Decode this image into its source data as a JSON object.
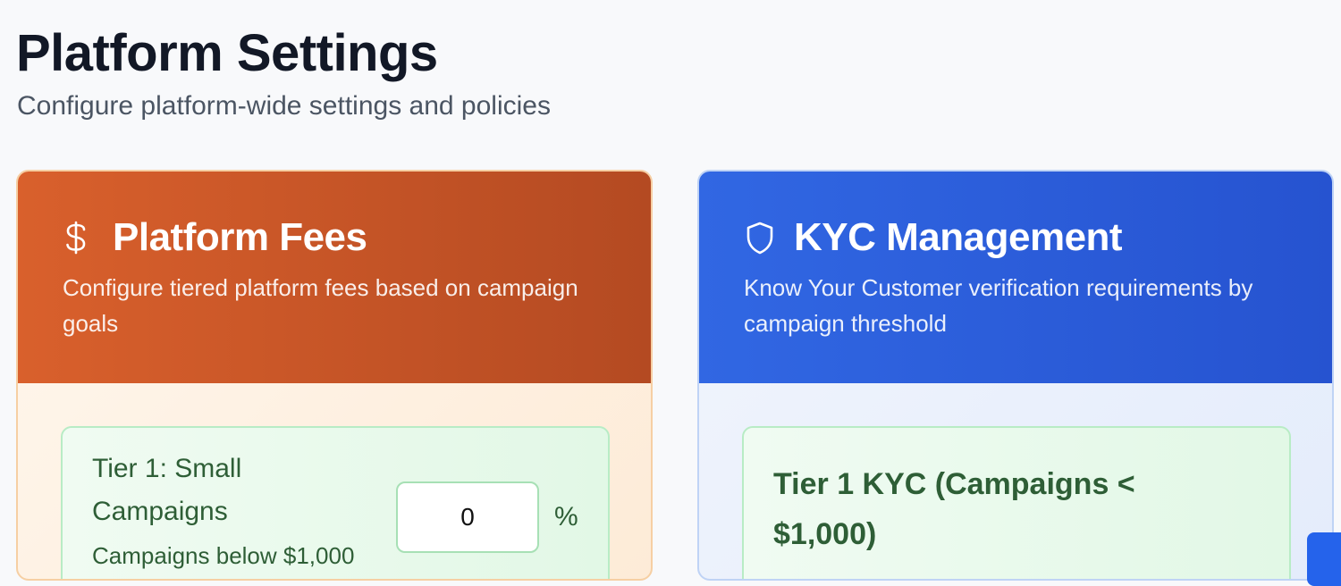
{
  "page": {
    "title": "Platform Settings",
    "subtitle": "Configure platform-wide settings and policies"
  },
  "fees_card": {
    "icon": "dollar-icon",
    "title": "Platform Fees",
    "description": "Configure tiered platform fees based on campaign goals",
    "accent_color": "#d9602c",
    "tier1": {
      "name": "Tier 1: Small Campaigns",
      "note": "Campaigns below $1,000",
      "fee_value": "0",
      "unit": "%"
    }
  },
  "kyc_card": {
    "icon": "shield-icon",
    "title": "KYC Management",
    "description": "Know Your Customer verification requirements by campaign threshold",
    "accent_color": "#3167e3",
    "tier1": {
      "title": "Tier 1 KYC (Campaigns < $1,000)"
    }
  },
  "floating_action": {
    "color": "#2563eb"
  }
}
